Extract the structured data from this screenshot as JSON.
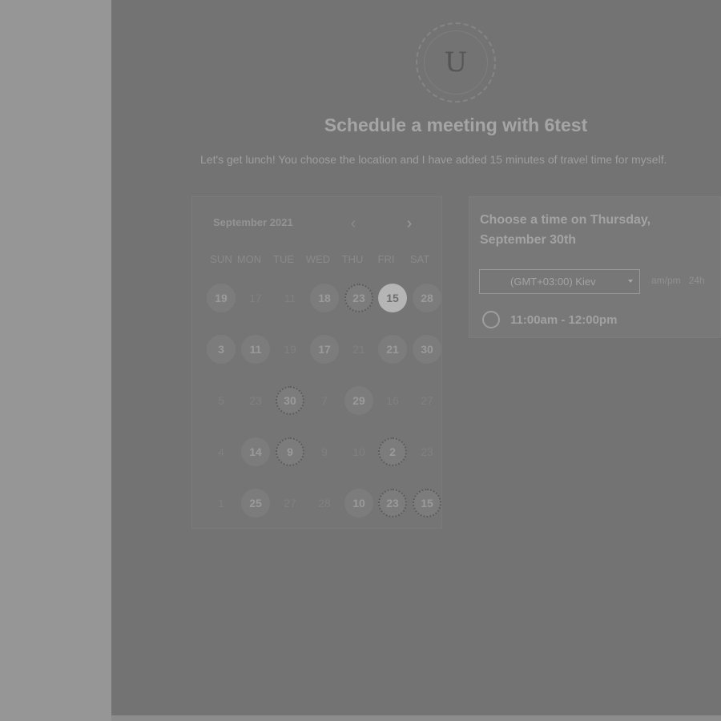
{
  "header": {
    "avatar_initial": "U",
    "title": "Schedule a meeting with 6test",
    "description": "Let's get lunch! You choose the location and I have added 15 minutes of travel time for myself."
  },
  "calendar": {
    "month_label": "September 2021",
    "prev_icon": "chevron-left-icon",
    "next_icon": "chevron-right-icon",
    "weekdays": [
      "SUN",
      "MON",
      "TUE",
      "WED",
      "THU",
      "FRI",
      "SAT"
    ],
    "rows": [
      [
        "19",
        "17",
        "11",
        "18",
        "23",
        "15",
        "28"
      ],
      [
        "3",
        "11",
        "19",
        "17",
        "21",
        "21",
        "30"
      ],
      [
        "5",
        "23",
        "30",
        "7",
        "29",
        "16",
        "27"
      ],
      [
        "4",
        "14",
        "9",
        "9",
        "10",
        "2",
        "23"
      ],
      [
        "1",
        "25",
        "27",
        "28",
        "10",
        "23",
        "15"
      ]
    ],
    "selected_day": "15"
  },
  "time_picker": {
    "heading": "Choose a time on Thursday, September 30th",
    "timezone": "(GMT+03:00) Kiev",
    "format_ampm": "am/pm",
    "format_24h": "24h",
    "slots": [
      "11:00am - 12:00pm"
    ]
  },
  "colors": {
    "page_background": "#969696",
    "content_background": "#737373",
    "selected_day": "#b5b5b5"
  }
}
